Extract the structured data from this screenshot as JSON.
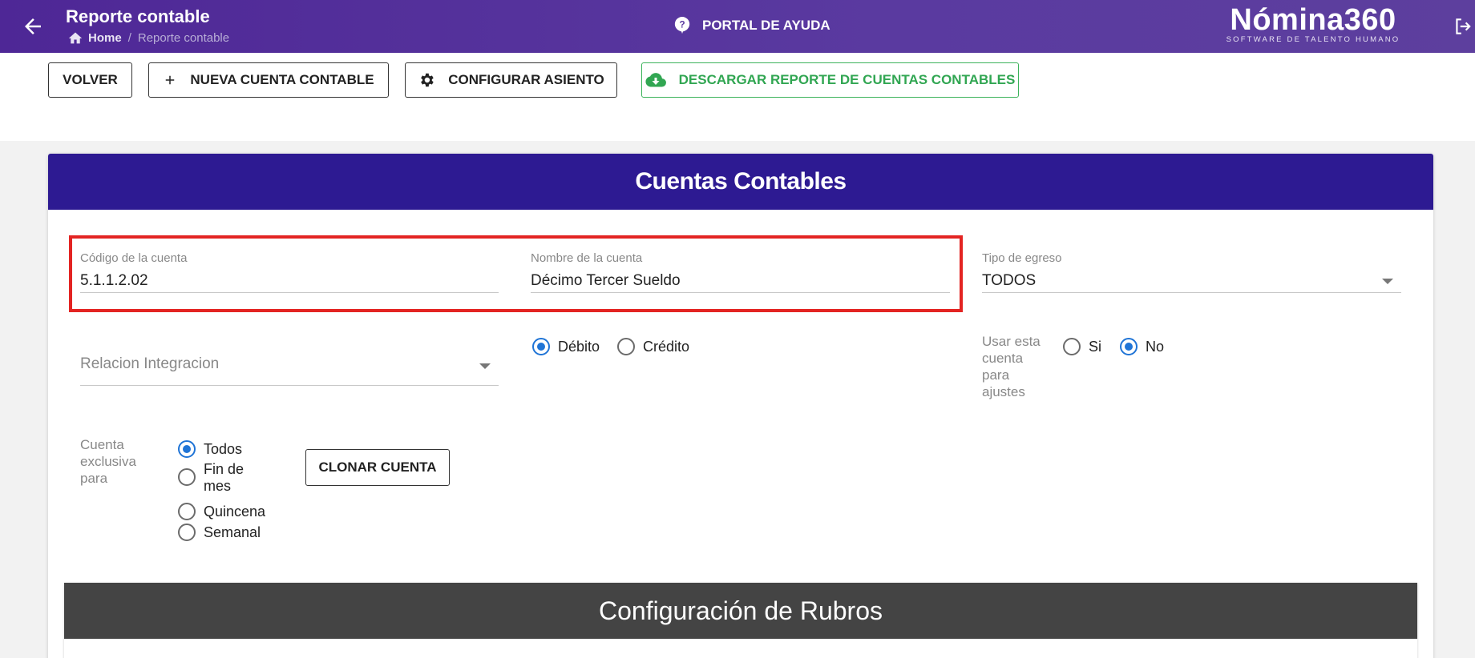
{
  "header": {
    "title": "Reporte contable",
    "breadcrumb": {
      "home": "Home",
      "separator": "/",
      "current": "Reporte contable"
    },
    "help_label": "PORTAL DE AYUDA",
    "brand_name": "Nómina360",
    "brand_tagline": "SOFTWARE DE TALENTO HUMANO"
  },
  "toolbar": {
    "volver": "VOLVER",
    "nueva_cuenta": "NUEVA CUENTA CONTABLE",
    "configurar_asiento": "CONFIGURAR ASIENTO",
    "descargar": "DESCARGAR REPORTE DE CUENTAS CONTABLES"
  },
  "card": {
    "title": "Cuentas Contables",
    "codigo": {
      "label": "Código de la cuenta",
      "value": "5.1.1.2.02"
    },
    "nombre": {
      "label": "Nombre de la cuenta",
      "value": "Décimo Tercer Sueldo"
    },
    "tipo_egreso": {
      "label": "Tipo de egreso",
      "value": "TODOS"
    },
    "relacion": {
      "placeholder": "Relacion Integracion"
    },
    "naturaleza": {
      "debito": "Débito",
      "credito": "Crédito",
      "selected": "debito"
    },
    "ajustes": {
      "label": "Usar esta cuenta para ajustes",
      "si": "Si",
      "no": "No",
      "selected": "no"
    },
    "exclusiva": {
      "label": "Cuenta exclusiva para",
      "options": [
        "Todos",
        "Fin de mes",
        "Quincena",
        "Semanal"
      ],
      "selected": "Todos"
    },
    "clonar": "CLONAR CUENTA"
  },
  "rubros": {
    "title": "Configuración de Rubros"
  },
  "colors": {
    "topbar": "#5a3aa0",
    "card_header": "#2d1a92",
    "radio_accent": "#1f74d6",
    "download_green": "#31a652",
    "highlight_red": "#e32422",
    "subcard_header": "#444444"
  }
}
